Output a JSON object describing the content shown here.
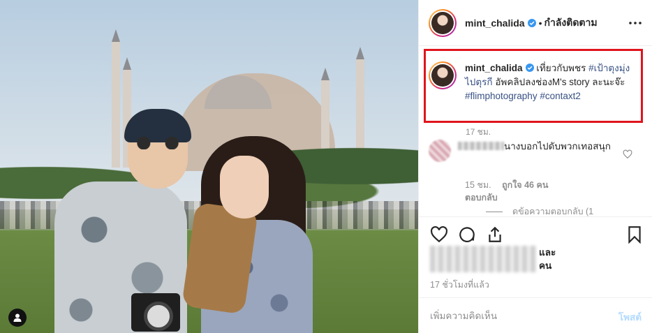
{
  "header": {
    "username": "mint_chalida",
    "separator": "•",
    "follow_status": "กำลังติดตาม"
  },
  "caption": {
    "username": "mint_chalida",
    "text_1": "เที่ยวกับพชร",
    "hashtag_1": "#เป้าตุงมุ่งไปตุรกี",
    "text_2": "อัพคลิปลงช่องM's story ละนะจ๊ะ",
    "hashtag_2": "#flimphotography",
    "hashtag_3": "#contaxt2",
    "time": "17 ชม."
  },
  "comment": {
    "text": "นางบอกไปดับพวกเทอสนุก",
    "time": "15 ชม.",
    "likes": "ถูกใจ 46 คน",
    "reply": "ตอบกลับ",
    "view_replies": "ดข้อความตอบกลับ (1"
  },
  "likes": {
    "and": "และ",
    "people": "คน"
  },
  "posted_time": "17 ชั่วโมงที่แล้ว",
  "comment_bar": {
    "placeholder": "เพิ่มความคิดเห็น",
    "post_label": "โพสต์"
  },
  "colors": {
    "verified": "#3897f0",
    "hashtag": "#385185",
    "highlight_box": "#e0141d",
    "post_disabled": "#b3dbff"
  }
}
